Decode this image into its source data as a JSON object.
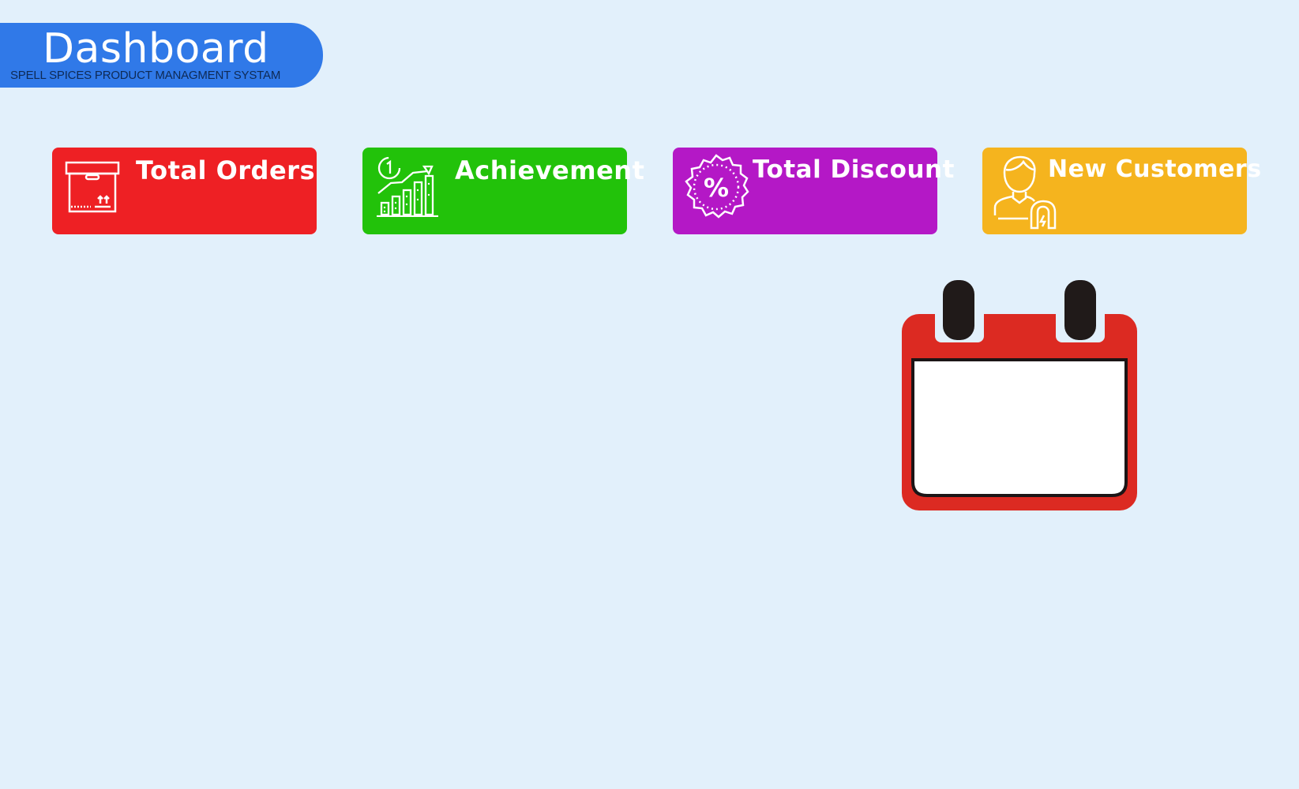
{
  "header": {
    "title": "Dashboard",
    "subtitle": "SPELL SPICES PRODUCT MANAGMENT SYSTAM",
    "color": "#3079e8"
  },
  "cards": [
    {
      "label": "Total Orders",
      "icon": "box-icon",
      "color": "#ee2024"
    },
    {
      "label": "Achievement",
      "icon": "growth-chart-icon",
      "color": "#22c20a"
    },
    {
      "label": "Total Discount",
      "icon": "discount-badge-icon",
      "color": "#b418c6"
    },
    {
      "label": "New Customers",
      "icon": "customer-magnet-icon",
      "color": "#f5b41e"
    }
  ],
  "calendar": {
    "icon": "calendar-icon",
    "color": "#dc2a22"
  }
}
